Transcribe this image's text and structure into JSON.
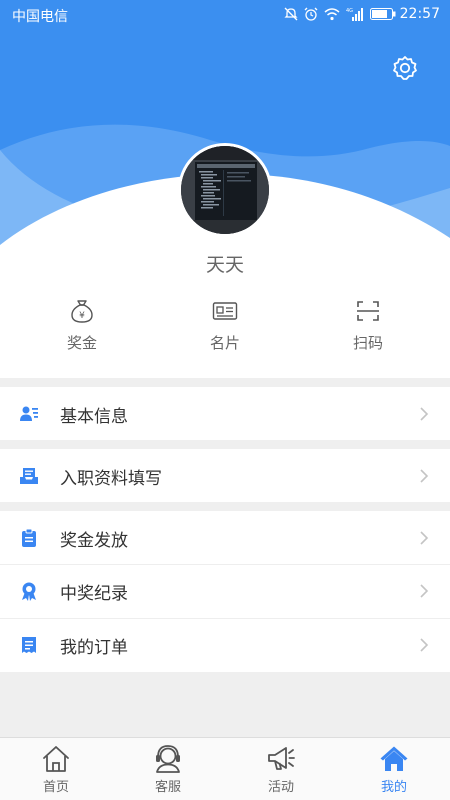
{
  "status_bar": {
    "carrier": "中国电信",
    "network_badge": "4G",
    "time": "22:57"
  },
  "profile": {
    "username": "天天"
  },
  "quick_actions": [
    {
      "label": "奖金",
      "icon": "money-bag-icon"
    },
    {
      "label": "名片",
      "icon": "id-card-icon"
    },
    {
      "label": "扫码",
      "icon": "scan-icon"
    }
  ],
  "menu": {
    "basic_info": "基本信息",
    "onboarding": "入职资料填写",
    "bonus_payout": "奖金发放",
    "prize_record": "中奖纪录",
    "my_orders": "我的订单"
  },
  "tabs": [
    {
      "label": "首页",
      "icon": "home-icon"
    },
    {
      "label": "客服",
      "icon": "customer-service-icon"
    },
    {
      "label": "活动",
      "icon": "megaphone-icon"
    },
    {
      "label": "我的",
      "icon": "home-filled-icon"
    }
  ],
  "colors": {
    "accent": "#3a86f2",
    "header_blue": "#3b8ff0",
    "background": "#efefef"
  }
}
